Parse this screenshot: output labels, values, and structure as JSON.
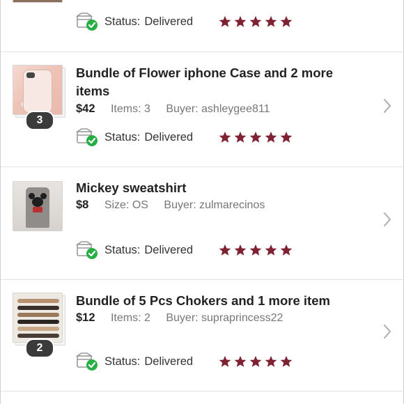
{
  "colors": {
    "star": "#7f2333",
    "check": "#27ae45",
    "divider": "#e3e3e3"
  },
  "icons": {
    "status": "package-delivered-icon",
    "rating": "star-icon",
    "nav": "chevron-right-icon"
  },
  "orders": [
    {
      "title": "",
      "price": "",
      "meta1": "",
      "buyer": "",
      "status_label": "Status:",
      "status_value": "Delivered",
      "rating": 5
    },
    {
      "title": "Bundle of Flower iphone Case and 2 more items",
      "price": "$42",
      "meta1": "Items: 3",
      "buyer": "Buyer: ashleygee811",
      "count_badge": "3",
      "status_label": "Status:",
      "status_value": "Delivered",
      "rating": 5
    },
    {
      "title": "Mickey sweatshirt",
      "price": "$8",
      "meta1": "Size: OS",
      "buyer": "Buyer: zulmarecinos",
      "status_label": "Status:",
      "status_value": "Delivered",
      "rating": 5
    },
    {
      "title": "Bundle of 5 Pcs Chokers and 1 more item",
      "price": "$12",
      "meta1": "Items: 2",
      "buyer": "Buyer: supraprincess22",
      "count_badge": "2",
      "status_label": "Status:",
      "status_value": "Delivered",
      "rating": 5
    }
  ]
}
